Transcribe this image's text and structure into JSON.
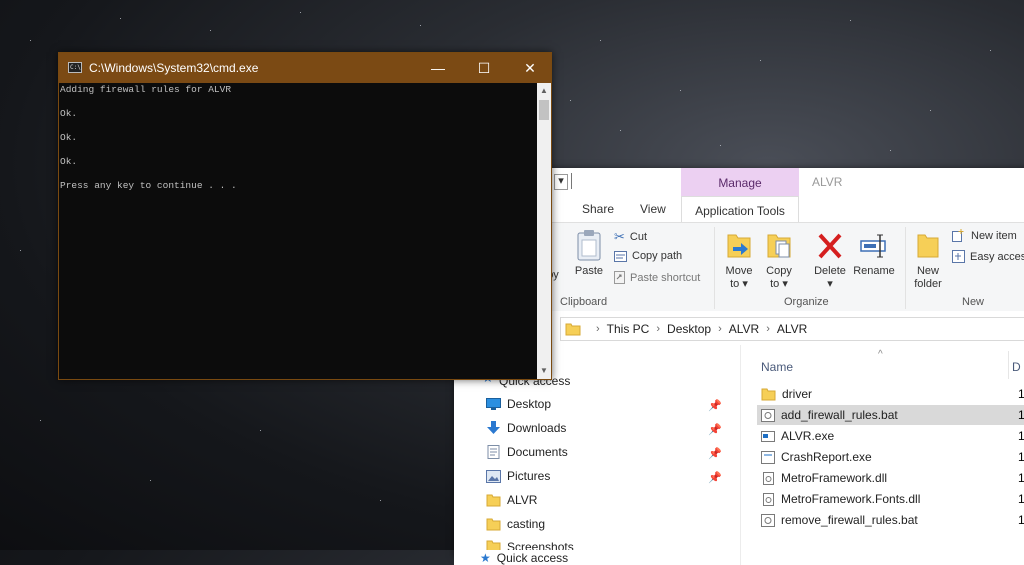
{
  "cmd": {
    "title": "C:\\Windows\\System32\\cmd.exe",
    "minimize": "—",
    "maximize": "☐",
    "close": "✕",
    "lines": [
      "Adding firewall rules for ALVR",
      "Ok.",
      "Ok.",
      "Ok.",
      "Press any key to continue . . ."
    ]
  },
  "explorer": {
    "manage_tab": "Manage",
    "window_title": "ALVR",
    "tabs": {
      "share": "Share",
      "view": "View",
      "app_tools": "Application Tools"
    },
    "ribbon": {
      "copy_partial": "py",
      "paste": "Paste",
      "cut": "Cut",
      "copy_path": "Copy path",
      "paste_shortcut": "Paste shortcut",
      "clipboard": "Clipboard",
      "move_to": "Move",
      "move_to_2": "to",
      "copy_to": "Copy",
      "copy_to_2": "to",
      "delete": "Delete",
      "rename": "Rename",
      "organize": "Organize",
      "new_folder": "New",
      "new_folder_2": "folder",
      "new_item": "New item",
      "easy_access": "Easy access",
      "new": "New"
    },
    "breadcrumb": [
      "This PC",
      "Desktop",
      "ALVR",
      "ALVR"
    ],
    "nav": {
      "quick_access": "Quick access",
      "items": [
        "Desktop",
        "Downloads",
        "Documents",
        "Pictures",
        "ALVR",
        "casting",
        "Screenshots"
      ]
    },
    "files": {
      "column_name": "Name",
      "column_next": "D",
      "rows": [
        "driver",
        "add_firewall_rules.bat",
        "ALVR.exe",
        "CrashReport.exe",
        "MetroFramework.dll",
        "MetroFramework.Fonts.dll",
        "remove_firewall_rules.bat"
      ],
      "tail": "1"
    }
  }
}
